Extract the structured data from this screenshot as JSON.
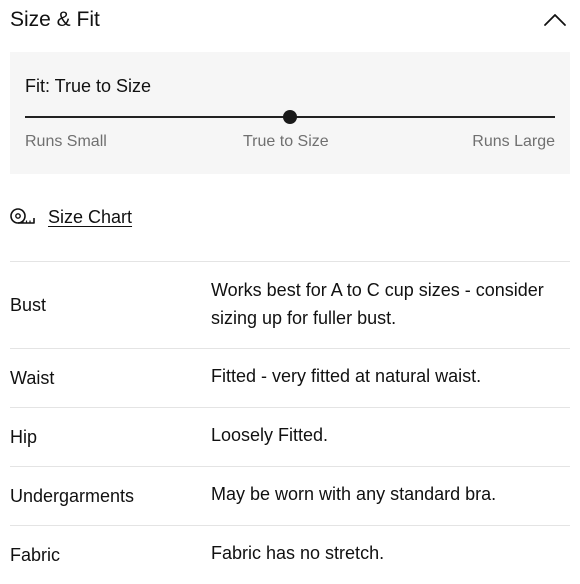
{
  "header": {
    "title": "Size & Fit",
    "collapse_icon": "chevron-up-icon"
  },
  "fit": {
    "label": "Fit: True to Size",
    "scale_left": "Runs Small",
    "scale_mid": "True to Size",
    "scale_right": "Runs Large",
    "slider_value": 0.5
  },
  "size_chart": {
    "icon": "measuring-tape-icon",
    "label": "Size Chart"
  },
  "specs": [
    {
      "label": "Bust",
      "value": "Works best for A to C cup sizes - consider sizing up for fuller bust."
    },
    {
      "label": "Waist",
      "value": "Fitted - very fitted at natural waist."
    },
    {
      "label": "Hip",
      "value": "Loosely Fitted."
    },
    {
      "label": "Undergarments",
      "value": "May be worn with any standard bra."
    },
    {
      "label": "Fabric",
      "value": "Fabric has no stretch."
    }
  ]
}
